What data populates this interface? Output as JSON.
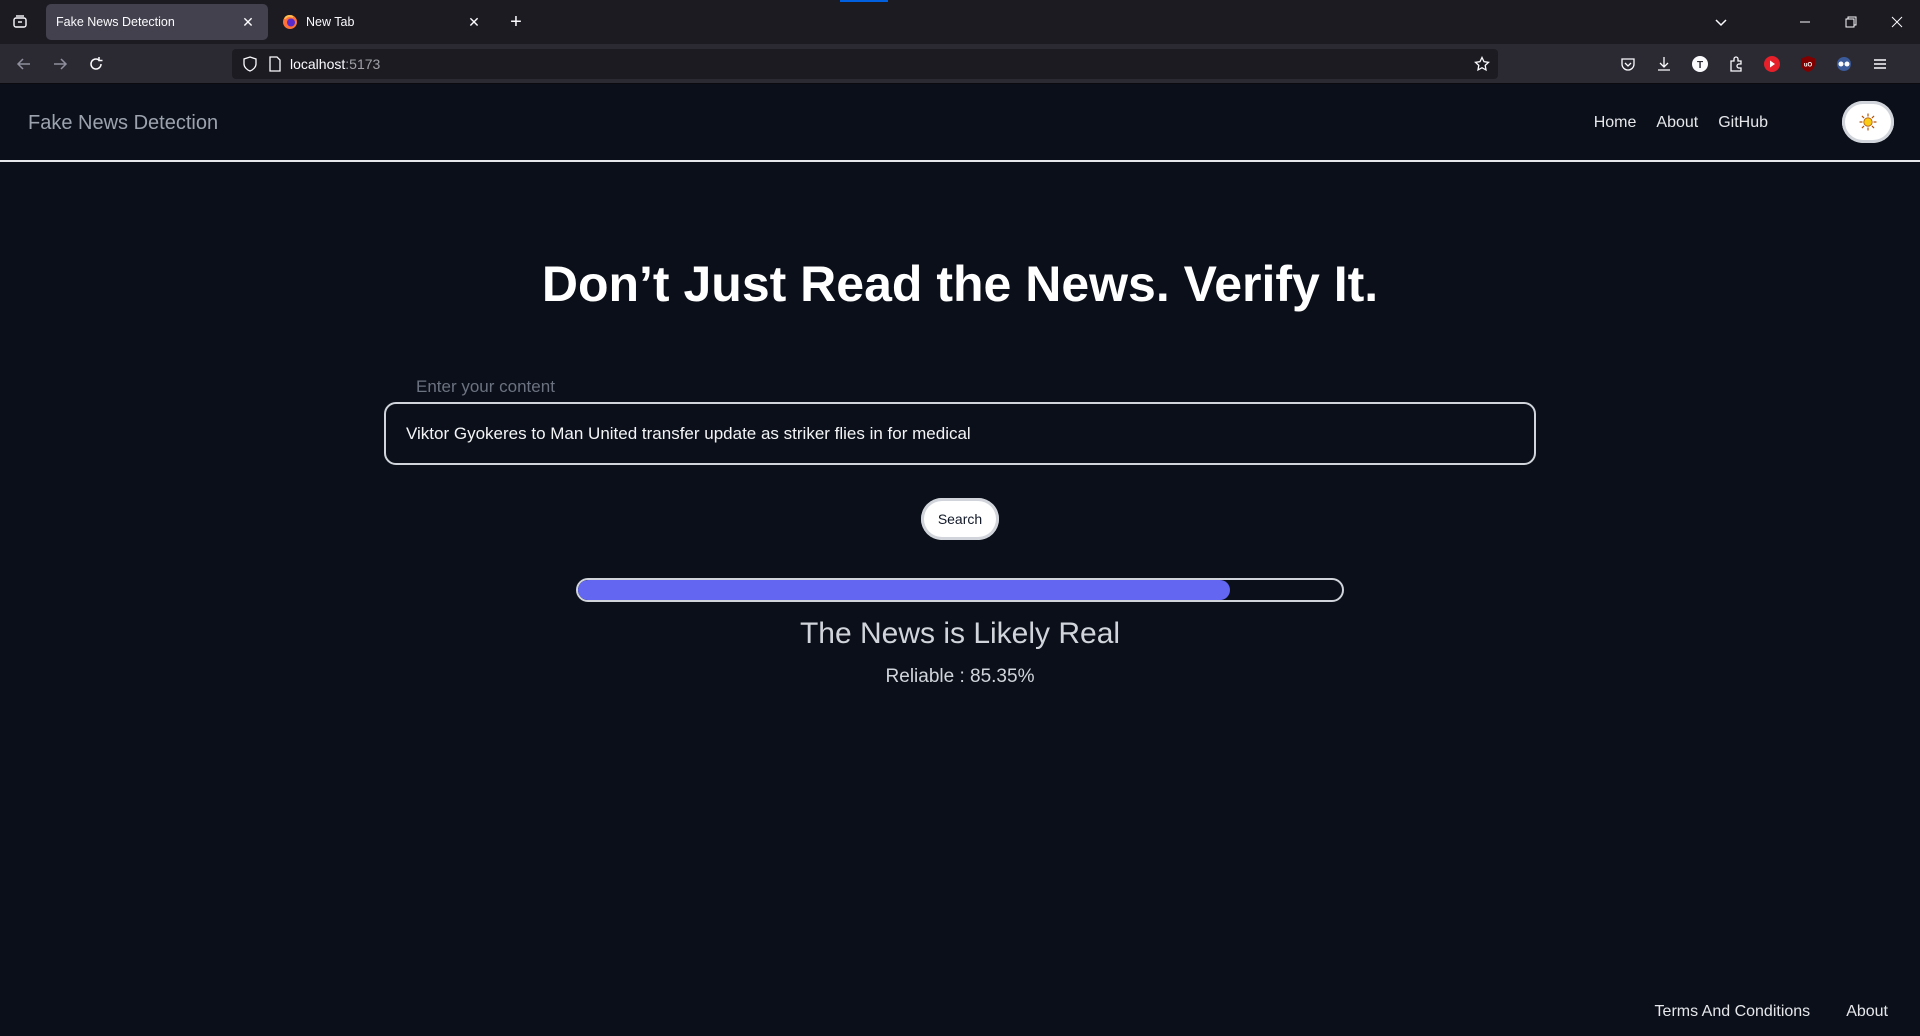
{
  "browser": {
    "tabs": [
      {
        "title": "Fake News Detection",
        "active": true
      },
      {
        "title": "New Tab",
        "active": false
      }
    ],
    "url_host": "localhost",
    "url_port": ":5173",
    "icons": {
      "tab_list": "tab-list-icon",
      "new_tab": "plus-icon",
      "back": "back-arrow-icon",
      "forward": "forward-arrow-icon",
      "reload": "reload-icon",
      "shield": "shield-icon",
      "page": "page-icon",
      "bookmark": "star-icon",
      "toolbar": [
        "pocket-icon",
        "download-icon",
        "t-extension-icon",
        "extensions-icon",
        "youtube-icon",
        "ublock-icon",
        "glasses-extension-icon",
        "menu-icon"
      ]
    }
  },
  "header": {
    "brand": "Fake News Detection",
    "nav": [
      "Home",
      "About",
      "GitHub"
    ],
    "theme_icon": "sun-icon"
  },
  "hero": {
    "title": "Don’t Just Read the News. Verify It."
  },
  "form": {
    "label": "Enter your content",
    "value": "Viktor Gyokeres to Man United transfer update as striker flies in for medical",
    "search_label": "Search"
  },
  "result": {
    "progress": 0.8535,
    "title": "The News is Likely Real",
    "score": "Reliable : 85.35%"
  },
  "footer": {
    "links": [
      "Terms And Conditions",
      "About"
    ]
  },
  "colors": {
    "background": "#0b0f19",
    "accent": "#6366f1"
  }
}
